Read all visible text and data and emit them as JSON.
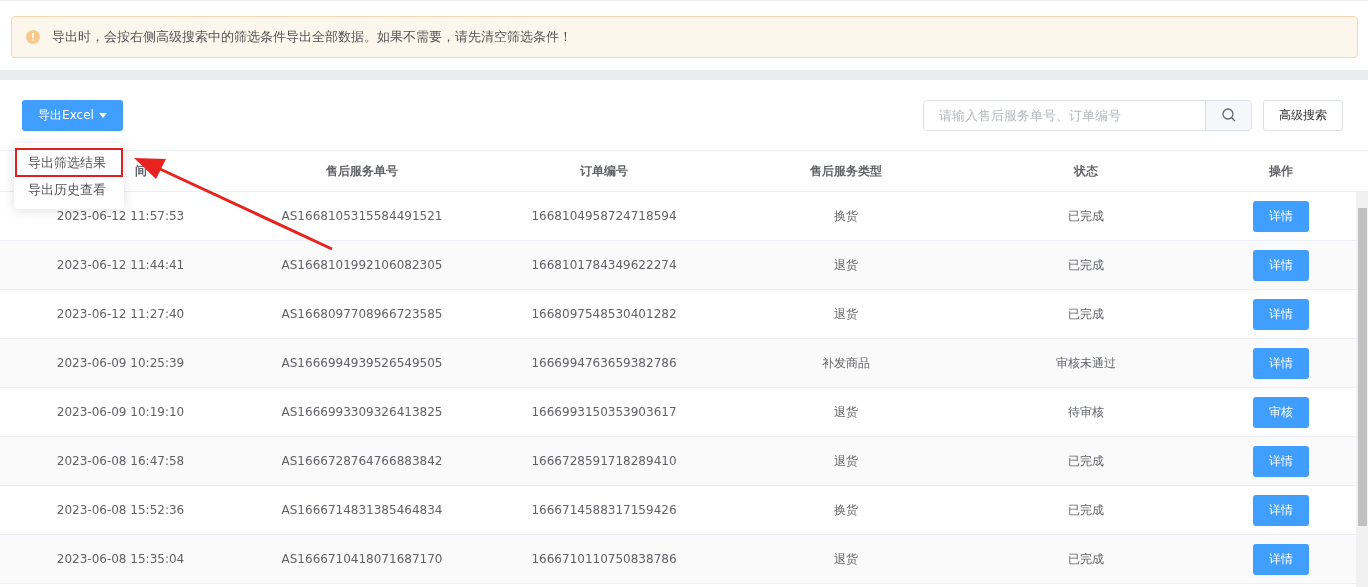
{
  "alert": {
    "text": "导出时，会按右侧高级搜索中的筛选条件导出全部数据。如果不需要，请先清空筛选条件！"
  },
  "toolbar": {
    "export_button": "导出Excel",
    "search": {
      "placeholder": "请输入售后服务单号、订单编号"
    },
    "advanced_button": "高级搜索"
  },
  "export_menu": {
    "expanded": true,
    "items": [
      {
        "label": "导出筛选结果",
        "highlighted": true
      },
      {
        "label": "导出历史查看",
        "highlighted": false
      }
    ]
  },
  "table": {
    "columns": [
      "间",
      "售后服务单号",
      "订单编号",
      "售后服务类型",
      "状态",
      "操作"
    ],
    "rows": [
      {
        "time": "2023-06-12 11:57:53",
        "service_no": "AS1668105315584491521",
        "order_no": "1668104958724718594",
        "type": "换货",
        "status": "已完成",
        "action": "详情"
      },
      {
        "time": "2023-06-12 11:44:41",
        "service_no": "AS1668101992106082305",
        "order_no": "1668101784349622274",
        "type": "退货",
        "status": "已完成",
        "action": "详情"
      },
      {
        "time": "2023-06-12 11:27:40",
        "service_no": "AS1668097708966723585",
        "order_no": "1668097548530401282",
        "type": "退货",
        "status": "已完成",
        "action": "详情"
      },
      {
        "time": "2023-06-09 10:25:39",
        "service_no": "AS1666994939526549505",
        "order_no": "1666994763659382786",
        "type": "补发商品",
        "status": "审核未通过",
        "action": "详情"
      },
      {
        "time": "2023-06-09 10:19:10",
        "service_no": "AS1666993309326413825",
        "order_no": "1666993150353903617",
        "type": "退货",
        "status": "待审核",
        "action": "审核"
      },
      {
        "time": "2023-06-08 16:47:58",
        "service_no": "AS1666728764766883842",
        "order_no": "1666728591718289410",
        "type": "退货",
        "status": "已完成",
        "action": "详情"
      },
      {
        "time": "2023-06-08 15:52:36",
        "service_no": "AS1666714831385464834",
        "order_no": "1666714588317159426",
        "type": "换货",
        "status": "已完成",
        "action": "详情"
      },
      {
        "time": "2023-06-08 15:35:04",
        "service_no": "AS1666710418071687170",
        "order_no": "1666710110750838786",
        "type": "退货",
        "status": "已完成",
        "action": "详情"
      }
    ]
  }
}
